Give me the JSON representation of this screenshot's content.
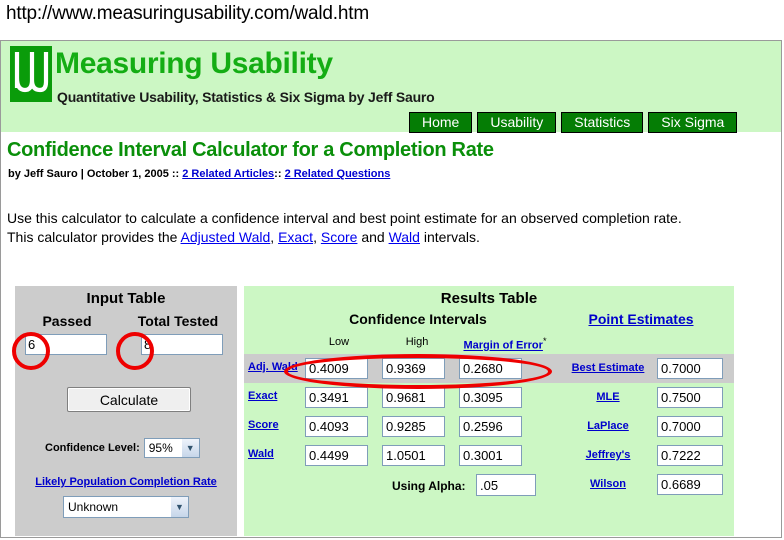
{
  "browser": {
    "url": "http://www.measuringusability.com/wald.htm"
  },
  "header": {
    "site_title": "Measuring Usability",
    "tagline": "Quantitative Usability, Statistics & Six Sigma by Jeff Sauro",
    "logo_icon": "mu-logo-icon",
    "nav": [
      {
        "label": "Home"
      },
      {
        "label": "Usability"
      },
      {
        "label": "Statistics"
      },
      {
        "label": "Six Sigma"
      }
    ]
  },
  "article": {
    "title": "Confidence Interval Calculator for a Completion Rate",
    "byline_author": "by Jeff Sauro | October 1, 2005 :: ",
    "byline_link1": "2 Related Articles",
    "byline_sep": ":: ",
    "byline_link2": "2 Related Questions",
    "intro_line1": "Use this calculator to calculate a confidence interval and best point estimate for an observed completion rate.",
    "intro_line2_a": "This calculator provides the ",
    "intro_link_adjwald": "Adjusted Wald",
    "intro_line2_b": ", ",
    "intro_link_exact": "Exact",
    "intro_line2_c": ", ",
    "intro_link_score": "Score",
    "intro_line2_d": " and ",
    "intro_link_wald": "Wald",
    "intro_line2_e": " intervals."
  },
  "input_table": {
    "title": "Input Table",
    "passed_label": "Passed",
    "total_label": "Total Tested",
    "passed_value": "6",
    "total_value": "8",
    "calculate_label": "Calculate",
    "confidence_level_label": "Confidence Level:",
    "confidence_level_value": "95%",
    "population_link": "Likely Population Completion Rate",
    "population_value": "Unknown"
  },
  "results_table": {
    "title": "Results Table",
    "confidence_intervals_heading": "Confidence Intervals",
    "point_estimates_heading": "Point Estimates",
    "col_low": "Low",
    "col_high": "High",
    "col_margin_of_error": "Margin of Error",
    "col_margin_of_error_footnote": "*",
    "rows": [
      {
        "label": "Adj. Wald",
        "low": "0.4009",
        "high": "0.9369",
        "moe": "0.2680"
      },
      {
        "label": "Exact",
        "low": "0.3491",
        "high": "0.9681",
        "moe": "0.3095"
      },
      {
        "label": "Score",
        "low": "0.4093",
        "high": "0.9285",
        "moe": "0.2596"
      },
      {
        "label": "Wald",
        "low": "0.4499",
        "high": "1.0501",
        "moe": "0.3001"
      }
    ],
    "point_estimates": [
      {
        "label": "Best Estimate",
        "value": "0.7000"
      },
      {
        "label": "MLE",
        "value": "0.7500"
      },
      {
        "label": "LaPlace",
        "value": "0.7000"
      },
      {
        "label": "Jeffrey's",
        "value": "0.7222"
      },
      {
        "label": "Wilson",
        "value": "0.6689"
      }
    ],
    "alpha_label": "Using Alpha:",
    "alpha_value": ".05"
  },
  "annotations": {
    "color": "#ee0000",
    "circles": [
      {
        "name": "passed-input-highlight"
      },
      {
        "name": "total-tested-input-highlight"
      },
      {
        "name": "adjusted-wald-row-highlight"
      }
    ]
  }
}
